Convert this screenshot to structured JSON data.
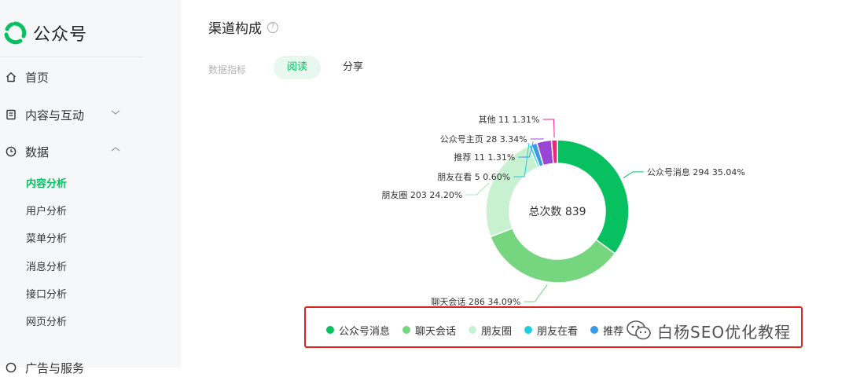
{
  "sidebar": {
    "brand_name": "公众号",
    "items": [
      {
        "label": "首页",
        "icon": "home-icon"
      },
      {
        "label": "内容与互动",
        "icon": "document-icon",
        "chevron": "chevron-down-icon"
      },
      {
        "label": "数据",
        "icon": "clock-icon",
        "chevron": "chevron-up-icon"
      }
    ],
    "sub_items": [
      "内容分析",
      "用户分析",
      "菜单分析",
      "消息分析",
      "接口分析",
      "网页分析"
    ],
    "active_sub": "内容分析",
    "partial_item": {
      "label": "广告与服务",
      "icon": "ad-service-icon"
    }
  },
  "main": {
    "title": "渠道构成",
    "metric_label": "数据指标",
    "tabs": [
      {
        "label": "阅读",
        "active": true
      },
      {
        "label": "分享",
        "active": false
      }
    ]
  },
  "chart_data": {
    "type": "pie",
    "center_label": "总次数 839",
    "total": 839,
    "slices": [
      {
        "name": "公众号消息",
        "value": 294,
        "percent": "35.04%",
        "color": "#07c160"
      },
      {
        "name": "聊天会话",
        "value": 286,
        "percent": "34.09%",
        "color": "#76d67f"
      },
      {
        "name": "朋友圈",
        "value": 203,
        "percent": "24.20%",
        "color": "#c8f1d2"
      },
      {
        "name": "朋友在看",
        "value": 5,
        "percent": "0.60%",
        "color": "#1dcfdd"
      },
      {
        "name": "推荐",
        "value": 11,
        "percent": "1.31%",
        "color": "#3a9be8"
      },
      {
        "name": "公众号主页",
        "value": 28,
        "percent": "3.34%",
        "color": "#9a45d6"
      },
      {
        "name": "其他",
        "value": 11,
        "percent": "1.31%",
        "color": "#f2237c"
      }
    ],
    "legend_visible": [
      "公众号消息",
      "聊天会话",
      "朋友圈",
      "朋友在看",
      "推荐"
    ]
  },
  "watermark": {
    "text": "白杨SEO优化教程"
  }
}
